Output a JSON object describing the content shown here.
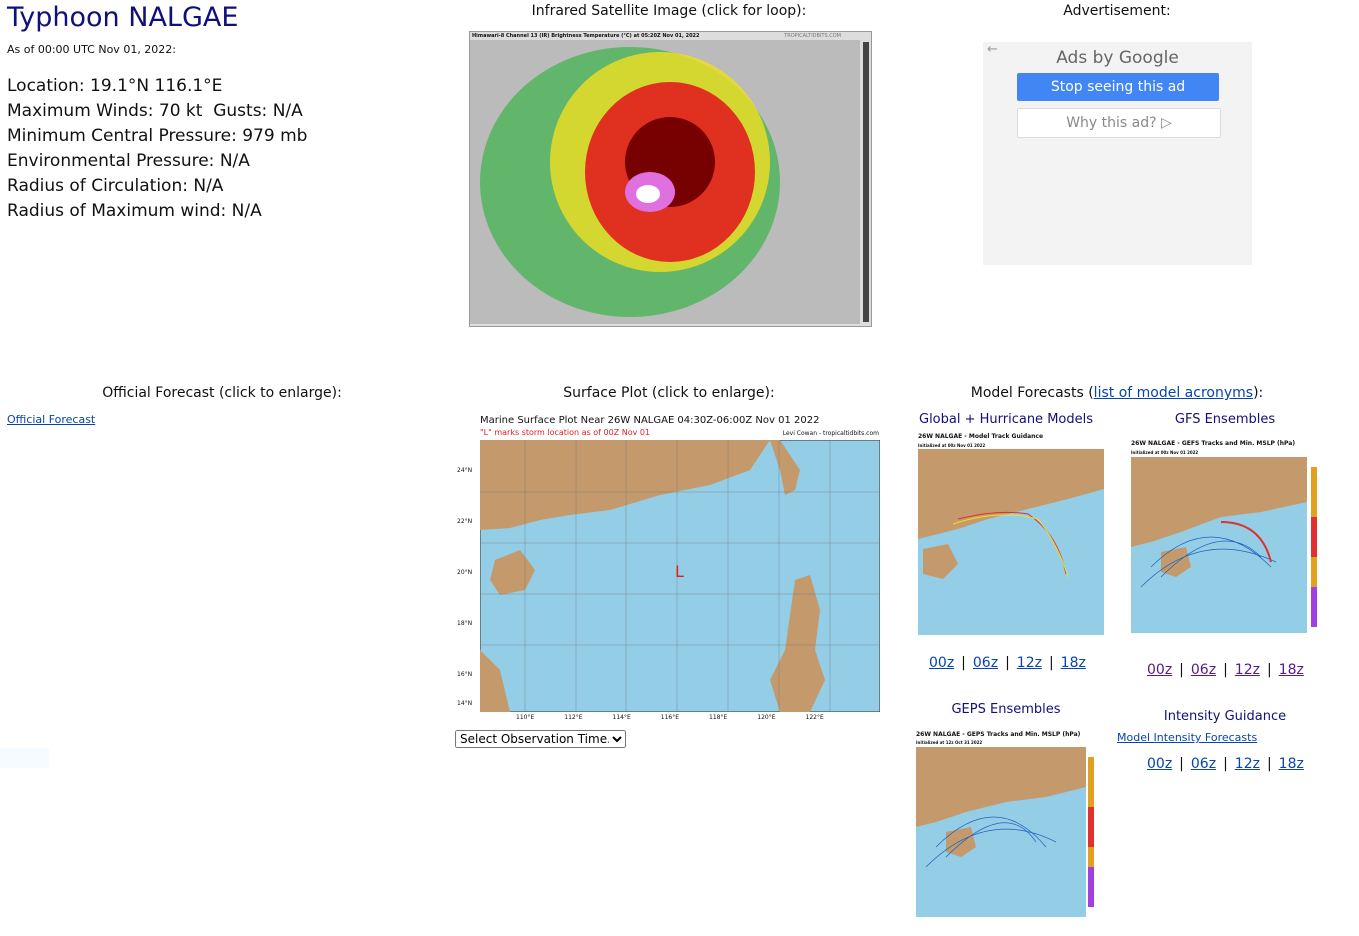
{
  "storm": {
    "title": "Typhoon NALGAE",
    "as_of": "As of 00:00 UTC Nov 01, 2022:",
    "lines": [
      "Location: 19.1°N 116.1°E",
      "Maximum Winds: 70 kt  Gusts: N/A",
      "Minimum Central Pressure: 979 mb",
      "Environmental Pressure: N/A",
      "Radius of Circulation: N/A",
      "Radius of Maximum wind: N/A"
    ]
  },
  "satellite": {
    "caption": "Infrared Satellite Image (click for loop):",
    "image_title": "Himawari-8 Channel 13 (IR) Brightness Temperature (°C) at 05:20Z Nov 01, 2022",
    "credit": "TROPICALTIDBITS.COM"
  },
  "ad": {
    "caption": "Advertisement:",
    "ads_by": "Ads by Google",
    "stop": "Stop seeing this ad",
    "why": "Why this ad? ▷"
  },
  "official": {
    "caption": "Official Forecast (click to enlarge):",
    "link": "Official Forecast"
  },
  "surface": {
    "caption": "Surface Plot (click to enlarge):",
    "image_title": "Marine Surface Plot Near 26W NALGAE 04:30Z-06:00Z Nov 01 2022",
    "subtitle": "\"L\" marks storm location as of 00Z Nov 01",
    "credit": "Levi Cowan - tropicaltidbits.com",
    "storm_marker": "L",
    "select": "Select Observation Time...",
    "lat_ticks": [
      "24°N",
      "22°N",
      "20°N",
      "18°N",
      "16°N",
      "14°N"
    ],
    "lon_ticks": [
      "110°E",
      "112°E",
      "114°E",
      "116°E",
      "118°E",
      "120°E",
      "122°E"
    ]
  },
  "models": {
    "caption_prefix": "Model Forecasts (",
    "caption_link": "list of model acronyms",
    "caption_suffix": "):",
    "global": {
      "caption": "Global + Hurricane Models",
      "image_title": "26W NALGAE - Model Track Guidance",
      "init": "Initialized at 00z Nov 01 2022"
    },
    "gfs": {
      "caption": "GFS Ensembles",
      "image_title": "26W NALGAE - GEFS Tracks and Min. MSLP (hPa)",
      "init": "Initialized at 00z Nov 01 2022"
    },
    "geps": {
      "caption": "GEPS Ensembles",
      "image_title": "26W NALGAE - GEPS Tracks and Min. MSLP (hPa)",
      "init": "Initialized at 12z Oct 31 2022"
    },
    "intensity": {
      "caption": "Intensity Guidance",
      "link": "Model Intensity Forecasts"
    },
    "runs": [
      "00z",
      "06z",
      "12z",
      "18z"
    ]
  },
  "colors": {
    "title": "#10107a",
    "ocean": "#94cde6",
    "land": "#c49a6c",
    "ad_button": "#4285f4"
  }
}
